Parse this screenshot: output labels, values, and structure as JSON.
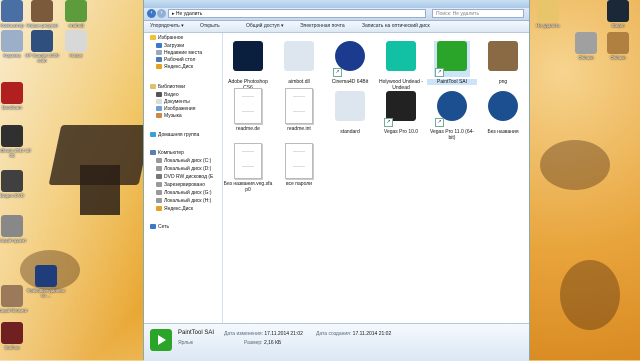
{
  "window": {
    "address": "Не удалить",
    "search_placeholder": "Поиск: Не удалить"
  },
  "toolbar": [
    "Упорядочить ▾",
    "Открыть",
    "Общий доступ ▾",
    "Электронная почта",
    "Записать на оптический диск"
  ],
  "navpane": {
    "favorites": "Избранное",
    "fav_items": [
      "Загрузки",
      "Недавние места",
      "Рабочий стол",
      "Яндекс.Диск"
    ],
    "libraries": "Библиотеки",
    "lib_items": [
      "Видео",
      "Документы",
      "Изображения",
      "Музыка"
    ],
    "homegroup": "Домашняя группа",
    "computer": "Компьютер",
    "comp_items": [
      "Локальный диск (C:)",
      "Локальный диск (D:)",
      "DVD RW дисковод (E",
      "Зарезервировано",
      "Локальный диск (G:)",
      "Локальный диск (H:)",
      "Яндекс.Диск"
    ],
    "network": "Сеть"
  },
  "files": [
    {
      "name": "Adobe Photoshop CS6",
      "icon": "photoshop-icon",
      "color": "#0a1f3d",
      "shortcut": false
    },
    {
      "name": "aimbot.dll",
      "icon": "dll-gear-icon",
      "color": "#dde6ef",
      "shortcut": false
    },
    {
      "name": "Cinema4D 64Bit",
      "icon": "cinema4d-icon",
      "color": "#1b3b8f",
      "shortcut": true
    },
    {
      "name": "Holywood Undead - Undead",
      "icon": "mp3-icon",
      "color": "#12c0a4",
      "shortcut": false
    },
    {
      "name": "PaintTool SAI",
      "icon": "painttool-icon",
      "color": "#2aa52a",
      "shortcut": true,
      "selected": true
    },
    {
      "name": "png",
      "icon": "minecraft-icon",
      "color": "#8a6a45",
      "shortcut": false
    },
    {
      "name": "readme.de",
      "icon": "text-document-icon",
      "color": "#ffffff",
      "shortcut": false
    },
    {
      "name": "readme.int",
      "icon": "text-document-icon",
      "color": "#ffffff",
      "shortcut": false
    },
    {
      "name": "standard",
      "icon": "settings-gear-icon",
      "color": "#dde6ef",
      "shortcut": false
    },
    {
      "name": "Vegas Pro 10.0",
      "icon": "vegas-icon",
      "color": "#222222",
      "shortcut": true
    },
    {
      "name": "Vegas Pro 11.0 (64-bit)",
      "icon": "vegas-lens-icon",
      "color": "#1b4f8f",
      "shortcut": true
    },
    {
      "name": "Без названия",
      "icon": "vegas-lens-icon",
      "color": "#1b4f8f",
      "shortcut": false
    },
    {
      "name": "Без названия.veg.sfa p0",
      "icon": "text-document-icon",
      "color": "#ffffff",
      "shortcut": false
    },
    {
      "name": "все пароли",
      "icon": "text-document-icon",
      "color": "#ffffff",
      "shortcut": false
    }
  ],
  "details": {
    "name": "PaintTool SAI",
    "type": "Ярлык",
    "modified_label": "Дата изменения:",
    "modified_value": "17.11.2014 21:02",
    "size_label": "Размер:",
    "size_value": "2,16 КБ",
    "created_label": "Дата создания:",
    "created_value": "17.11.2014 21:02"
  },
  "desktop_left": [
    {
      "label": "Компьютер",
      "color": "#4a6fa5"
    },
    {
      "label": "Новые рисунки",
      "color": "#7a5a3a"
    },
    {
      "label": "Android",
      "color": "#5c9c3c"
    },
    {
      "label": "Корзина",
      "color": "#9bb0c8"
    },
    {
      "label": "HP Scanjet 2400 scan",
      "color": "#2f4f7f"
    },
    {
      "label": "Новое",
      "color": "#d8d8d8"
    },
    {
      "label": "Bandicam",
      "color": "#b02020"
    },
    {
      "label": "Bandicam 2014 10 05",
      "color": "#303030"
    },
    {
      "label": "Видео DVD",
      "color": "#404040"
    },
    {
      "label": "Новый проект",
      "color": "#888888"
    },
    {
      "label": "Новый блокнот",
      "color": "#9a7a5a"
    },
    {
      "label": "Фейковые данные по ...",
      "color": "#1f3d7a"
    },
    {
      "label": "Stuff.se",
      "color": "#702020"
    }
  ],
  "desktop_right": [
    {
      "label": "Не удалить",
      "color": "#e8c46a"
    },
    {
      "label": "Steam",
      "color": "#1b2838"
    },
    {
      "label": "Облако",
      "color": "#a0a0a0"
    },
    {
      "label": "Облако",
      "color": "#b08040"
    }
  ]
}
